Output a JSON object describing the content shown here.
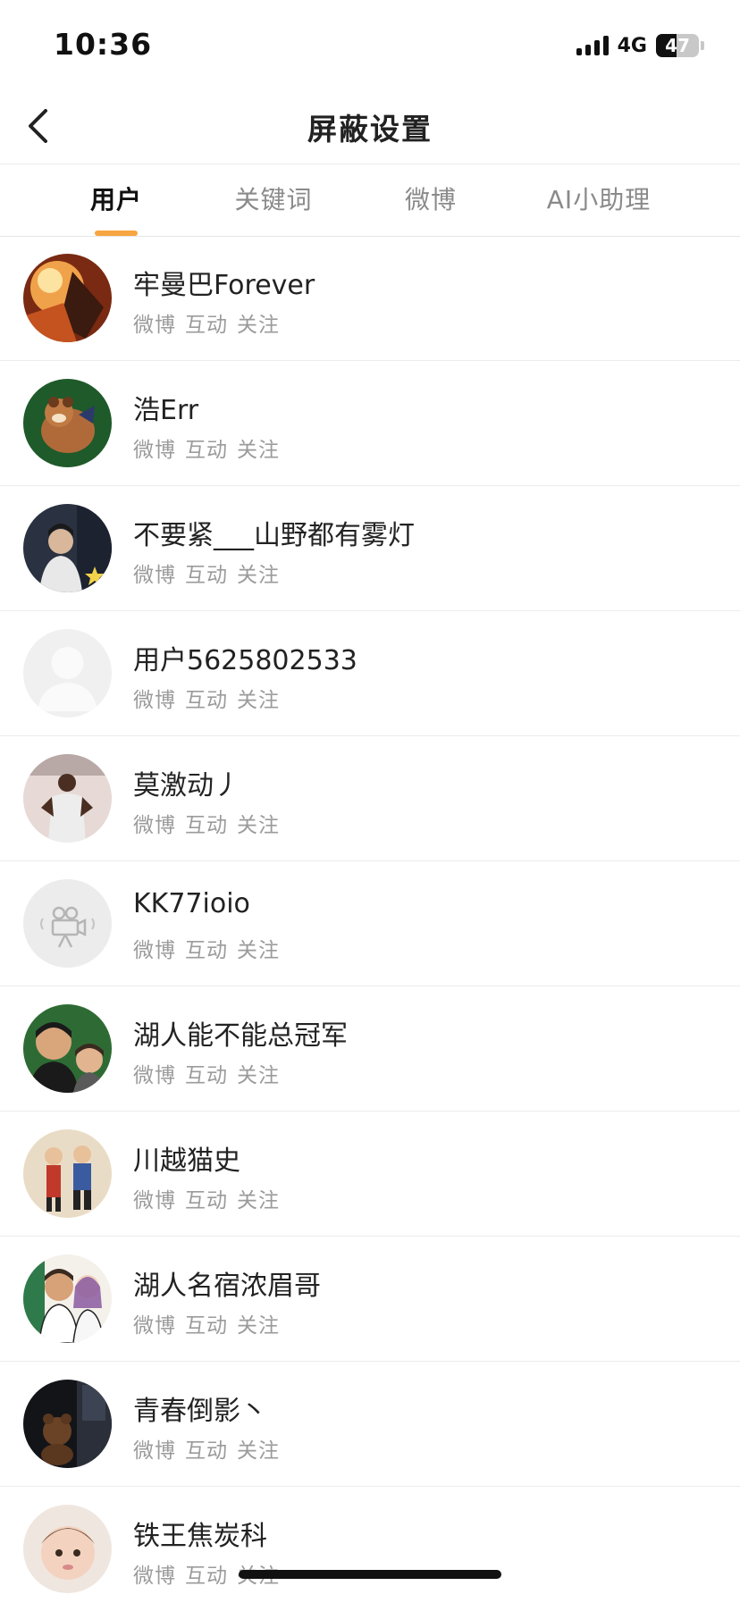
{
  "status_bar": {
    "time": "10:36",
    "network": "4G",
    "battery": "47",
    "battery_level": 0.47
  },
  "header": {
    "title": "屏蔽设置",
    "back_icon": "chevron-left-icon"
  },
  "tabs": [
    {
      "label": "用户",
      "active": true
    },
    {
      "label": "关键词",
      "active": false
    },
    {
      "label": "微博",
      "active": false
    },
    {
      "label": "AI小助理",
      "active": false
    }
  ],
  "users": [
    {
      "name": "牢曼巴Forever",
      "tags": [
        "微博",
        "互动",
        "关注"
      ]
    },
    {
      "name": "浩Err",
      "tags": [
        "微博",
        "互动",
        "关注"
      ]
    },
    {
      "name": "不要紧___山野都有雾灯",
      "tags": [
        "微博",
        "互动",
        "关注"
      ]
    },
    {
      "name": "用户5625802533",
      "tags": [
        "微博",
        "互动",
        "关注"
      ]
    },
    {
      "name": "莫激动丿",
      "tags": [
        "微博",
        "互动",
        "关注"
      ]
    },
    {
      "name": "KK77ioio",
      "tags": [
        "微博",
        "互动",
        "关注"
      ]
    },
    {
      "name": "湖人能不能总冠军",
      "tags": [
        "微博",
        "互动",
        "关注"
      ]
    },
    {
      "name": "川越猫史",
      "tags": [
        "微博",
        "互动",
        "关注"
      ]
    },
    {
      "name": "湖人名宿浓眉哥",
      "tags": [
        "微博",
        "互动",
        "关注"
      ]
    },
    {
      "name": "青春倒影丶",
      "tags": [
        "微博",
        "互动",
        "关注"
      ]
    },
    {
      "name": "铁王焦炭科",
      "tags": [
        "微博",
        "互动",
        "关注"
      ]
    }
  ],
  "colors": {
    "accent": "#f7a541",
    "divider": "#ececec",
    "secondary_text": "#9b9b9b"
  }
}
